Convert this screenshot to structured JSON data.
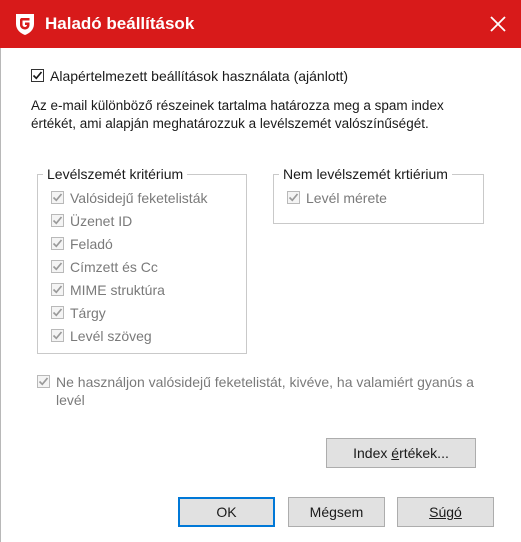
{
  "window": {
    "title": "Haladó beállítások",
    "accent_color": "#d81a1a",
    "icons": {
      "logo": "gdata-shield-icon",
      "close": "close-icon"
    }
  },
  "use_defaults": {
    "label": "Alapértelmezett beállítások használata (ajánlott)",
    "checked": true
  },
  "description": "Az e-mail különböző részeinek tartalma határozza meg a spam index értékét, ami alapján meghatározzuk a levélszemét valószínűségét.",
  "spam_criteria": {
    "title": "Levélszemét kritérium",
    "items": [
      {
        "label": "Valósidejű feketelisták",
        "checked": true,
        "enabled": false
      },
      {
        "label": "Üzenet ID",
        "checked": true,
        "enabled": false
      },
      {
        "label": "Feladó",
        "checked": true,
        "enabled": false
      },
      {
        "label": "Címzett és Cc",
        "checked": true,
        "enabled": false
      },
      {
        "label": "MIME struktúra",
        "checked": true,
        "enabled": false
      },
      {
        "label": "Tárgy",
        "checked": true,
        "enabled": false
      },
      {
        "label": "Levél szöveg",
        "checked": true,
        "enabled": false
      }
    ]
  },
  "non_spam_criteria": {
    "title": "Nem levélszemét krtiérium",
    "items": [
      {
        "label": "Levél mérete",
        "checked": true,
        "enabled": false
      }
    ]
  },
  "blacklist_option": {
    "label": "Ne használjon valósidejű feketelistát, kivéve, ha valamiért gyanús a levél",
    "checked": true,
    "enabled": false
  },
  "buttons": {
    "index_prefix": "Index ",
    "index_mnemonic": "é",
    "index_suffix": "rtékek...",
    "ok": "OK",
    "cancel": "Mégsem",
    "help_mnemonic": "S",
    "help_suffix": "úgó"
  }
}
